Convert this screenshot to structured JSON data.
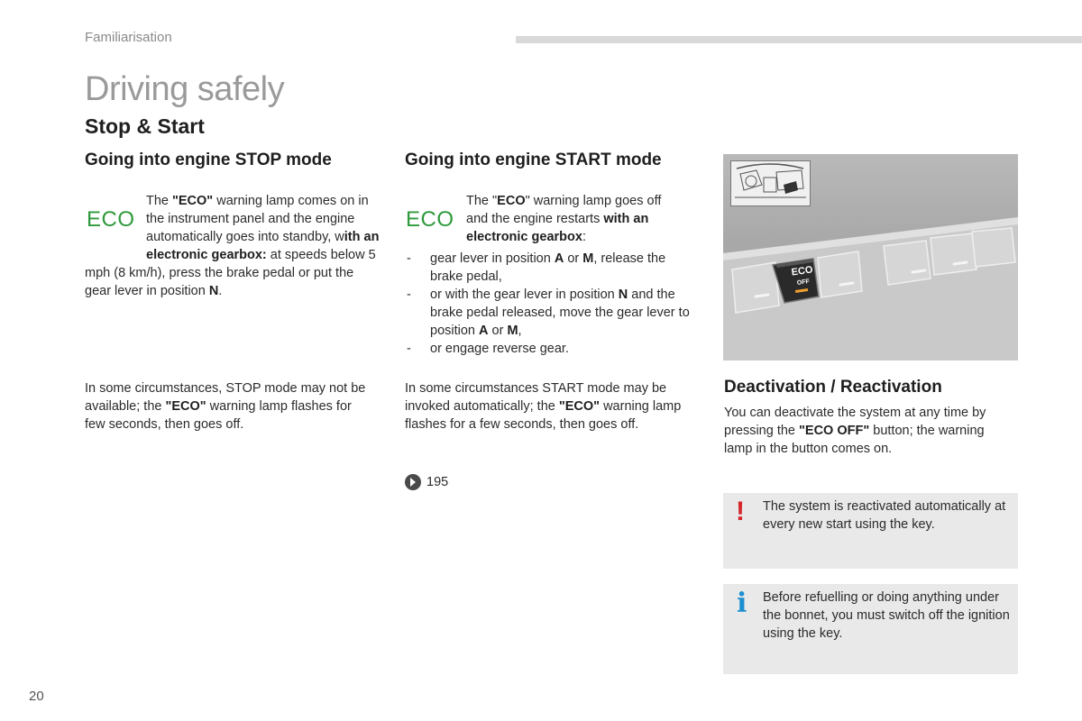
{
  "header": {
    "section": "Familiarisation",
    "title": "Driving safely",
    "subtitle": "Stop & Start"
  },
  "stop_column": {
    "heading": "Going into engine STOP mode",
    "eco_icon": "ECO",
    "para1": {
      "t1": "The ",
      "b1": "\"ECO\"",
      "t2": " warning lamp comes on in the instrument panel and the engine automatically goes into standby, w",
      "b2": "ith an electronic gearbox:",
      "t3": " at speeds below 5 mph (8 km/h), press the brake pedal or put the gear lever in position ",
      "b3": "N",
      "t4": "."
    },
    "para2": {
      "t1": "In some circumstances, STOP mode may not be available; the ",
      "b1": "\"ECO\"",
      "t2": " warning lamp flashes for few seconds, then goes off."
    }
  },
  "start_column": {
    "heading": "Going into engine START mode",
    "eco_icon": "ECO",
    "para1": {
      "t1": "The \"",
      "b1": "ECO",
      "t2": "\" warning lamp goes off and the engine restarts ",
      "b2": "with an electronic gearbox",
      "t3": ":"
    },
    "bullets": {
      "b1": {
        "t1": "gear lever in position ",
        "b1": "A",
        "t2": " or ",
        "b2": "M",
        "t3": ", release the brake pedal,"
      },
      "b2": {
        "t1": "or with the gear lever in position ",
        "b1": "N",
        "t2": " and the brake pedal released, move the gear lever to position ",
        "b2": "A",
        "t3": " or ",
        "b3": "M",
        "t4": ","
      },
      "b3": {
        "t1": "or engage reverse gear."
      }
    },
    "para2": {
      "t1": "In some circumstances START mode may be invoked automatically; the ",
      "b1": "\"ECO\"",
      "t2": " warning lamp flashes for a few seconds, then goes off."
    },
    "xref_page": "195",
    "xref_icon": "page-reference-icon"
  },
  "right_column": {
    "photo": {
      "button_label_line1": "ECO",
      "button_label_line2": "OFF"
    },
    "heading": "Deactivation / Reactivation",
    "para": {
      "t1": "You can deactivate the system at any time by pressing the ",
      "b1": "\"ECO OFF\"",
      "t2": " button; the warning lamp in the button comes on."
    },
    "warning_box": {
      "icon": "!",
      "text": "The system is reactivated automatically at every new start using the key."
    },
    "info_box": {
      "icon": "i",
      "text": "Before refuelling or doing anything under the bonnet, you must switch off the ignition using the key."
    }
  },
  "footer": {
    "page_number": "20"
  },
  "colors": {
    "eco_green": "#2e9a3c",
    "warning_red": "#d7262d",
    "info_blue": "#1d8fd0",
    "box_grey": "#e9e9e9"
  }
}
